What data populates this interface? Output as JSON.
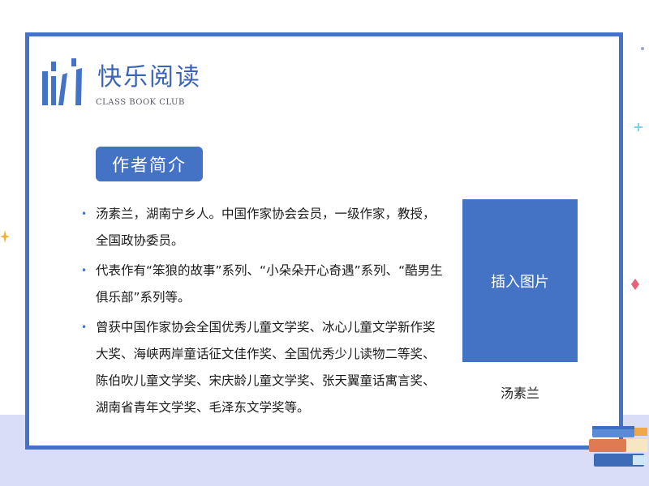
{
  "header": {
    "title": "快乐阅读",
    "subtitle": "CLASS BOOK CLUB",
    "logo_icon": "books-logo-icon"
  },
  "section": {
    "heading": "作者简介"
  },
  "bio": {
    "items": [
      "汤素兰，湖南宁乡人。中国作家协会会员，一级作家，教授，全国政协委员。",
      "代表作有“笨狼的故事”系列、“小朵朵开心奇遇”系列、“酷男生俱乐部”系列等。",
      "曾获中国作家协会全国优秀儿童文学奖、冰心儿童文学新作奖大奖、海峡两岸童话征文佳作奖、全国优秀少儿读物二等奖、陈伯吹儿童文学奖、宋庆龄儿童文学奖、张天翼童话寓言奖、湖南省青年文学奖、毛泽东文学奖等。"
    ],
    "bullet": "•"
  },
  "image_placeholder": {
    "label": "插入图片"
  },
  "author_caption": "汤素兰",
  "colors": {
    "accent": "#4472c4",
    "band": "#d9ddf7"
  }
}
